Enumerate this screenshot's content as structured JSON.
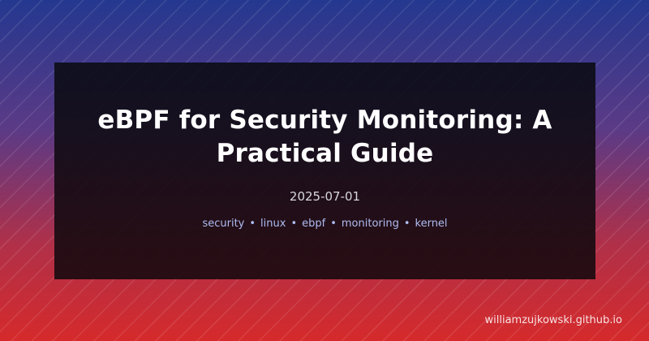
{
  "post": {
    "title": "eBPF for Security Monitoring: A Practical Guide",
    "date": "2025-07-01",
    "tags": [
      "security",
      "linux",
      "ebpf",
      "monitoring",
      "kernel"
    ],
    "separator": "•"
  },
  "site": {
    "url": "williamzujkowski.github.io"
  },
  "colors": {
    "gradient_top": "#24388f",
    "gradient_bottom": "#d52a2b",
    "card_background": "#120c16",
    "title": "#ffffff",
    "date": "#d7d8dc",
    "tags": "#aebcf1"
  }
}
